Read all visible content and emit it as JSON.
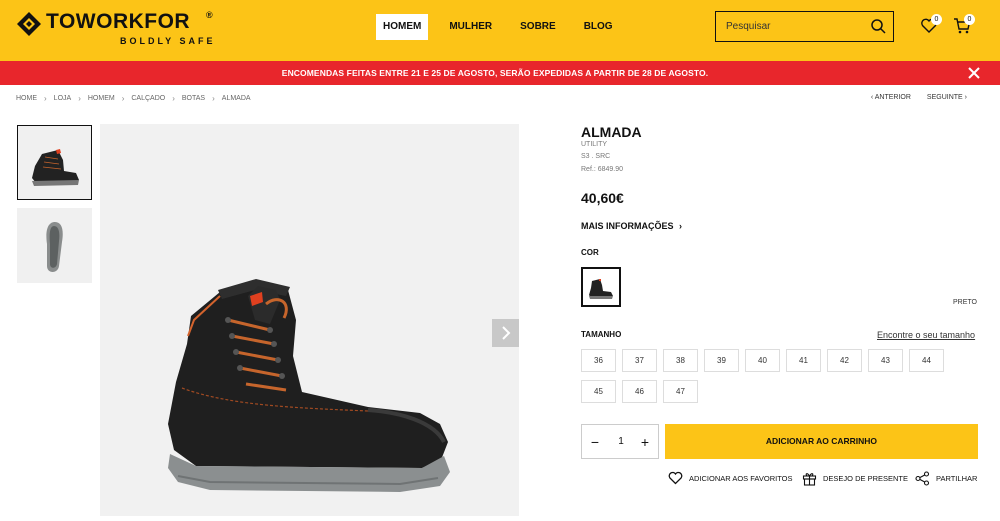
{
  "header": {
    "brand": "TOWORKFOR",
    "brand_reg": "®",
    "tagline": "BOLDLY SAFE",
    "nav": [
      {
        "label": "HOMEM",
        "active": true
      },
      {
        "label": "MULHER",
        "active": false
      },
      {
        "label": "SOBRE",
        "active": false
      },
      {
        "label": "BLOG",
        "active": false
      }
    ],
    "search_placeholder": "Pesquisar",
    "wishlist_count": "0",
    "cart_count": "0",
    "icons": [
      "search-icon",
      "heart-icon",
      "cart-icon"
    ]
  },
  "announcement": {
    "text": "ENCOMENDAS FEITAS ENTRE 21 E 25 DE AGOSTO, SERÃO EXPEDIDAS A PARTIR DE 28 DE AGOSTO.",
    "close_icon": "close-icon"
  },
  "breadcrumb": [
    "HOME",
    "LOJA",
    "HOMEM",
    "CALÇADO",
    "BOTAS",
    "ALMADA"
  ],
  "pager": {
    "prev": "ANTERIOR",
    "next": "SEGUINTE"
  },
  "product": {
    "name": "ALMADA",
    "category": "UTILITY",
    "norm": "S3 . SRC",
    "ref": "Ref.: 6849.90",
    "price": "40,60€",
    "more_info": "MAIS INFORMAÇÕES",
    "color_label": "COR",
    "color_name": "PRETO",
    "size_label": "TAMANHO",
    "size_guide": "Encontre o seu tamanho",
    "sizes": [
      "36",
      "37",
      "38",
      "39",
      "40",
      "41",
      "42",
      "43",
      "44",
      "45",
      "46",
      "47"
    ],
    "quantity": "1",
    "add_to_cart": "ADICIONAR AO CARRINHO",
    "actions": {
      "favorites": "ADICIONAR AOS FAVORITOS",
      "gift": "DESEJO DE PRESENTE",
      "share": "PARTILHAR"
    }
  },
  "colors": {
    "accent": "#fcc417",
    "banner": "#e8262c",
    "text": "#111111"
  }
}
